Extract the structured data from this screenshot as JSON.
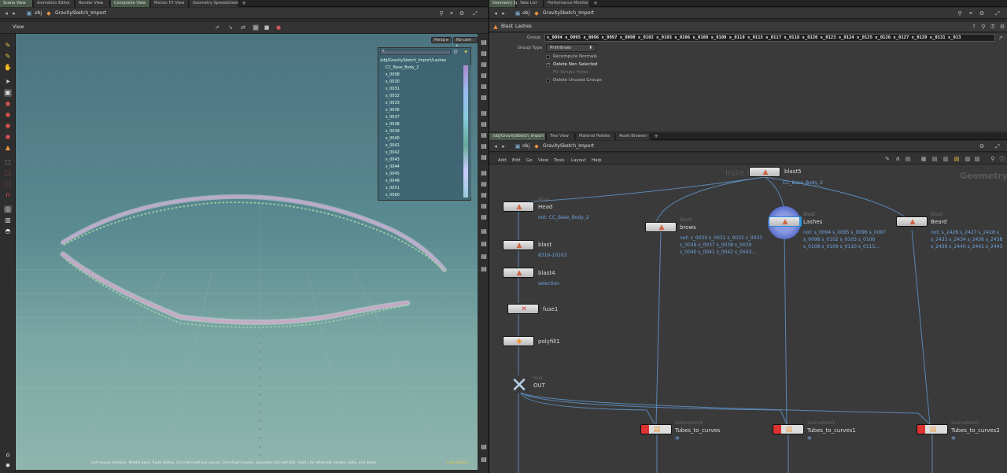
{
  "left_tabs": [
    "Scene View",
    "Animation Editor",
    "Render View",
    "Composite View",
    "Motion FX View",
    "Geometry Spreadsheet"
  ],
  "right_tabs": [
    "Geometry Spreadsheet",
    "Take List",
    "Performance Monitor"
  ],
  "left_path": {
    "obj": "obj",
    "node": "GravitySketch_Import"
  },
  "right_path": {
    "obj": "obj",
    "node": "GravitySketch_Import"
  },
  "viewport": {
    "label": "View",
    "persp": "Persp ▸",
    "cam": "No cam ▸",
    "status": "Left mouse tumbles. Middle pans. Right dollies. Ctrl+Alt+Left box zooms. Ctrl+Right zooms. Spacebar-Ctrl-Left tilts. Hold L for alternate tumble, dolly, and zoom.",
    "corner_label": "indie Edition"
  },
  "group_list": {
    "path": "/obj/GravitySketch_Import/Lashes",
    "items": [
      "CC_Base_Body_2",
      "s_0008",
      "s_0030",
      "s_0031",
      "s_0032",
      "s_0033",
      "s_0036",
      "s_0037",
      "s_0038",
      "s_0039",
      "s_0040",
      "s_0041",
      "s_0042",
      "s_0043",
      "s_0044",
      "s_0045",
      "s_0048",
      "s_0051",
      "s_0060"
    ]
  },
  "params": {
    "type": "Blast",
    "name": "Lashes",
    "group_label": "Group",
    "group_value": "s_0094 s_0095 s_0096 s_0097 s_0098 s_0102 s_0103 s_0106 s_0108 s_0109 s_0110 s_0115 s_0117 s_0118 s_0120 s_0123 s_0124 s_0125 s_0126 s_0127 s_0129 s_0131 s_013",
    "group_type_label": "Group Type",
    "group_type_value": "Primitives",
    "options": [
      {
        "label": "Recompute Normals",
        "checked": false
      },
      {
        "label": "Delete Non Selected",
        "checked": true
      },
      {
        "label": "Fill Simple Holes",
        "checked": false,
        "disabled": true
      },
      {
        "label": "Delete Unused Groups",
        "checked": false
      }
    ]
  },
  "net_tabs": [
    "/obj/GravitySketch_Import",
    "Tree View",
    "Material Palette",
    "Asset Browser"
  ],
  "net_path": {
    "obj": "obj",
    "node": "GravitySketch_Import"
  },
  "net_menu": [
    "Add",
    "Edit",
    "Go",
    "View",
    "Tools",
    "Layout",
    "Help"
  ],
  "net_labels": {
    "indie": "Indie Edition",
    "context": "Geometry"
  },
  "nodes": {
    "blast5": {
      "name": "blast5",
      "info": "CC_Base_Body_2"
    },
    "head": {
      "type": "Blast",
      "name": "Head",
      "info": "not: CC_Base_Body_2"
    },
    "blast": {
      "name": "blast",
      "info": "8316-10103"
    },
    "blast4": {
      "name": "blast4",
      "info": "selection"
    },
    "fuse1": {
      "name": "fuse1"
    },
    "polyfill1": {
      "name": "polyfill1"
    },
    "out": {
      "type": "Null",
      "name": "OUT"
    },
    "brows": {
      "type": "Blast",
      "name": "brows",
      "info": "not: s_0030 s_0031 s_0032 s_0033\ns_0036 s_0037 s_0038 s_0039\ns_0040 s_0041 s_0042 s_0043..."
    },
    "lashes": {
      "type": "Blast",
      "name": "Lashes",
      "info": "not: s_0094 s_0095 s_0096 s_0097\ns_0098 s_0102 s_0103 s_0106\ns_0108 s_0109 s_0110 s_0115..."
    },
    "beard": {
      "type": "Blast",
      "name": "Beard",
      "info": "not: s_2426 s_2427 s_2428 s_\ns_2433 s_2434 s_2436 s_2438\ns_2439 s_2440 s_2441 s_2443"
    },
    "t2c": {
      "type": "Subnetwork",
      "name": "Tubes_to_curves"
    },
    "t2c1": {
      "type": "Subnetwork",
      "name": "Tubes_to_curves1"
    },
    "t2c2": {
      "type": "Subnetwork",
      "name": "Tubes_to_curves2"
    }
  },
  "colors": {
    "accent": "#6fa6e0",
    "viewport_top": "#4c7480",
    "viewport_bottom": "#8fb5ad",
    "node_selected": "#5a6ecc"
  }
}
